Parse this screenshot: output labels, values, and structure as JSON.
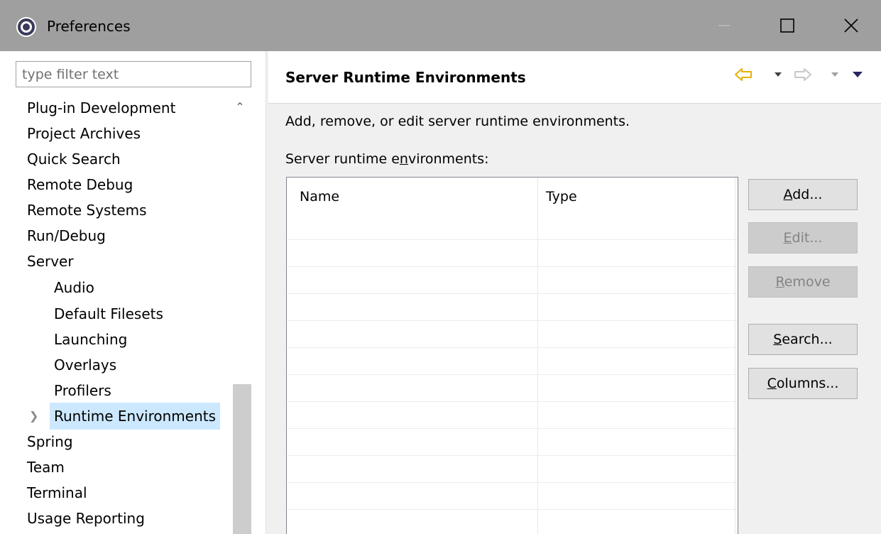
{
  "window": {
    "title": "Preferences"
  },
  "sidebar": {
    "filter_placeholder": "type filter text",
    "items": [
      {
        "label": "Plug-in Development",
        "level": 0
      },
      {
        "label": "Project Archives",
        "level": 0
      },
      {
        "label": "Quick Search",
        "level": 0
      },
      {
        "label": "Remote Debug",
        "level": 0
      },
      {
        "label": "Remote Systems",
        "level": 0
      },
      {
        "label": "Run/Debug",
        "level": 0
      },
      {
        "label": "Server",
        "level": 0
      },
      {
        "label": "Audio",
        "level": 1
      },
      {
        "label": "Default Filesets",
        "level": 1
      },
      {
        "label": "Launching",
        "level": 1
      },
      {
        "label": "Overlays",
        "level": 1
      },
      {
        "label": "Profilers",
        "level": 1
      },
      {
        "label": "Runtime Environments",
        "level": 1,
        "selected": true
      },
      {
        "label": "Spring",
        "level": 0
      },
      {
        "label": "Team",
        "level": 0
      },
      {
        "label": "Terminal",
        "level": 0
      },
      {
        "label": "Usage Reporting",
        "level": 0
      }
    ]
  },
  "page": {
    "title": "Server Runtime Environments",
    "description": "Add, remove, or edit server runtime environments.",
    "list_label_pre": "Server runtime e",
    "list_label_mnemonic": "n",
    "list_label_post": "vironments:",
    "table": {
      "columns": [
        "Name",
        "Type"
      ],
      "rows": []
    }
  },
  "buttons": {
    "add": {
      "mnemonic": "A",
      "rest": "dd..."
    },
    "edit": {
      "mnemonic": "E",
      "rest": "dit..."
    },
    "remove": {
      "mnemonic": "R",
      "rest": "emove"
    },
    "search": {
      "mnemonic": "S",
      "rest": "earch..."
    },
    "columns": {
      "mnemonic": "C",
      "rest": "olumns..."
    }
  },
  "colors": {
    "selection": "#cce8ff",
    "titlebar": "#9f9f9f",
    "nav_back": "#e8b100"
  }
}
